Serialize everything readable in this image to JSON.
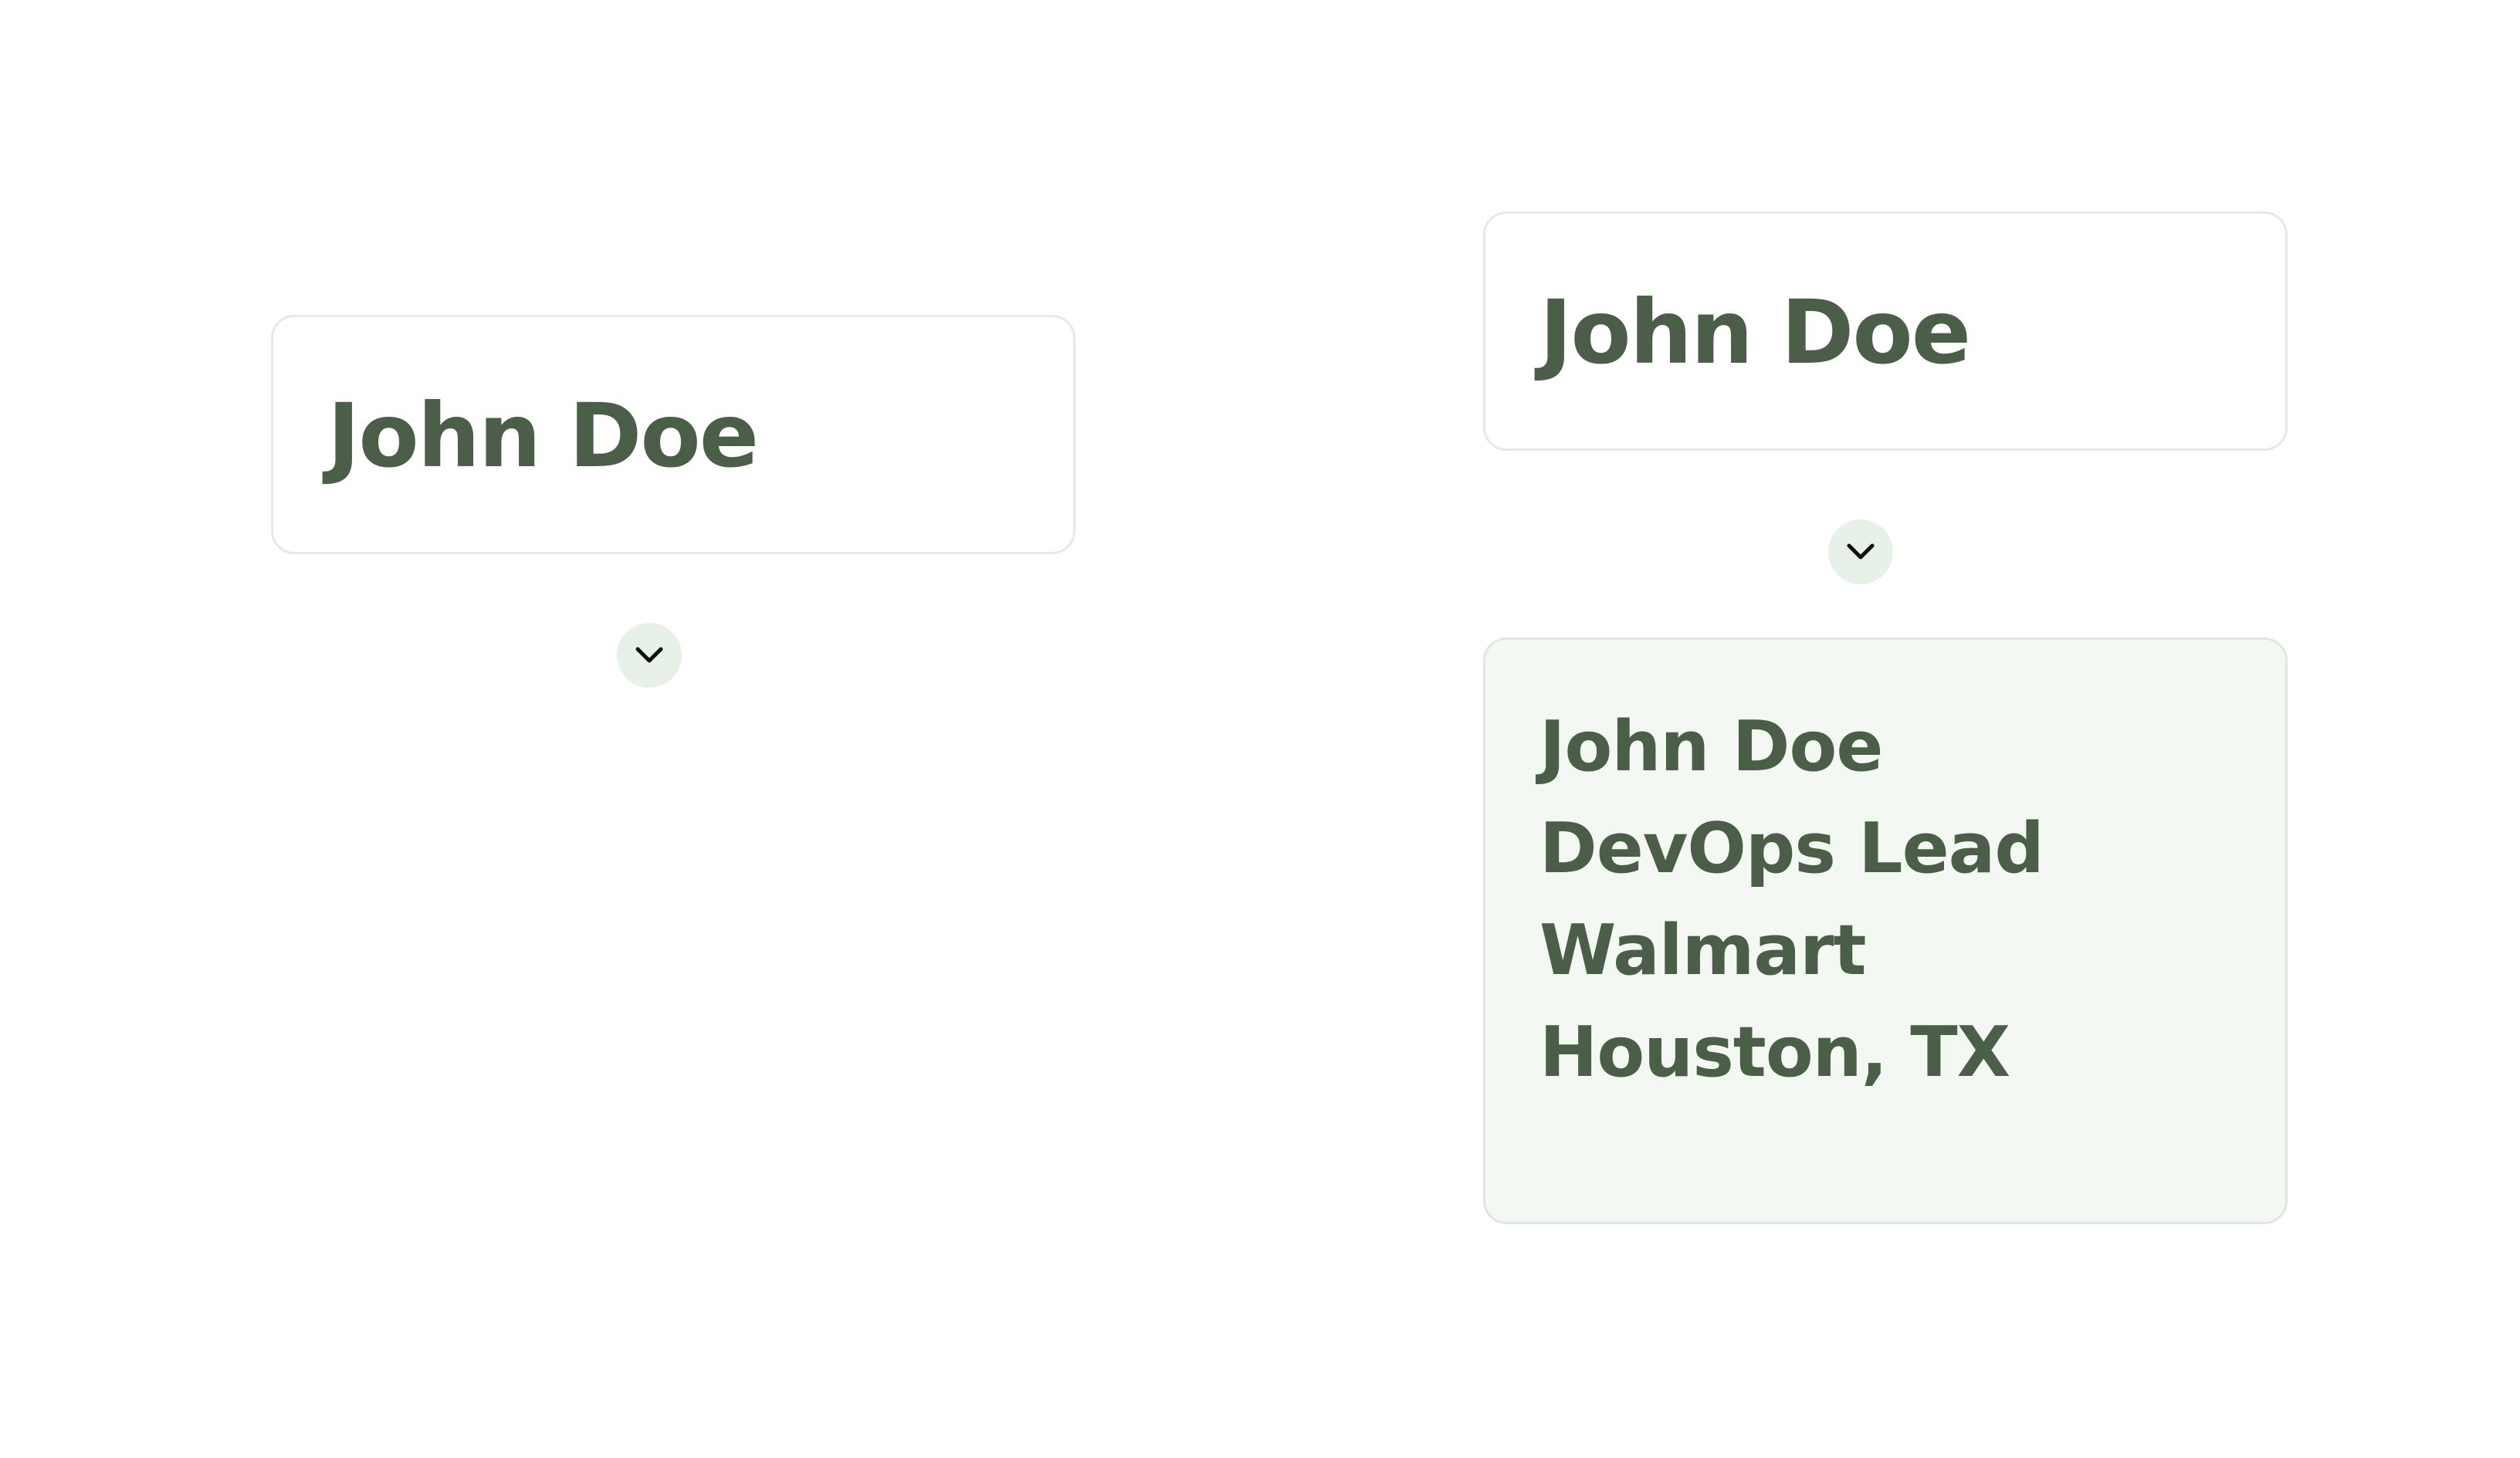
{
  "colors": {
    "text": "#4a5e48",
    "toggle_bg": "#e8f1e8",
    "details_bg": "#f3f8f3",
    "card_border": "#e6e9e6"
  },
  "collapsed_card": {
    "name": "John Doe",
    "toggle_icon": "chevron-down-icon"
  },
  "expanded_card": {
    "name": "John Doe",
    "toggle_icon": "chevron-down-icon",
    "details": {
      "name": "John Doe",
      "title": "DevOps Lead",
      "company": "Walmart",
      "location": "Houston, TX"
    }
  }
}
